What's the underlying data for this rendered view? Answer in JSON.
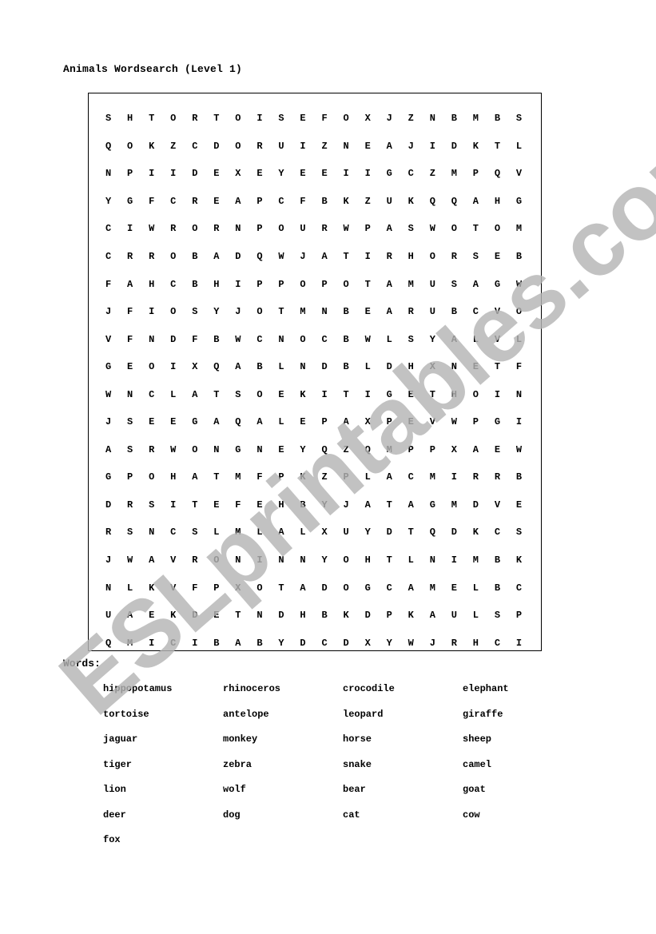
{
  "title": "Animals Wordsearch (Level 1)",
  "grid": [
    [
      "S",
      "H",
      "T",
      "O",
      "R",
      "T",
      "O",
      "I",
      "S",
      "E",
      "F",
      "O",
      "X",
      "J",
      "Z",
      "N",
      "B",
      "M",
      "B",
      "S"
    ],
    [
      "Q",
      "O",
      "K",
      "Z",
      "C",
      "D",
      "O",
      "R",
      "U",
      "I",
      "Z",
      "N",
      "E",
      "A",
      "J",
      "I",
      "D",
      "K",
      "T",
      "L"
    ],
    [
      "N",
      "P",
      "I",
      "I",
      "D",
      "E",
      "X",
      "E",
      "Y",
      "E",
      "E",
      "I",
      "I",
      "G",
      "C",
      "Z",
      "M",
      "P",
      "Q",
      "V"
    ],
    [
      "Y",
      "G",
      "F",
      "C",
      "R",
      "E",
      "A",
      "P",
      "C",
      "F",
      "B",
      "K",
      "Z",
      "U",
      "K",
      "Q",
      "Q",
      "A",
      "H",
      "G"
    ],
    [
      "C",
      "I",
      "W",
      "R",
      "O",
      "R",
      "N",
      "P",
      "O",
      "U",
      "R",
      "W",
      "P",
      "A",
      "S",
      "W",
      "O",
      "T",
      "O",
      "M"
    ],
    [
      "C",
      "R",
      "R",
      "O",
      "B",
      "A",
      "D",
      "Q",
      "W",
      "J",
      "A",
      "T",
      "I",
      "R",
      "H",
      "O",
      "R",
      "S",
      "E",
      "B"
    ],
    [
      "F",
      "A",
      "H",
      "C",
      "B",
      "H",
      "I",
      "P",
      "P",
      "O",
      "P",
      "O",
      "T",
      "A",
      "M",
      "U",
      "S",
      "A",
      "G",
      "W"
    ],
    [
      "J",
      "F",
      "I",
      "O",
      "S",
      "Y",
      "J",
      "O",
      "T",
      "M",
      "N",
      "B",
      "E",
      "A",
      "R",
      "U",
      "B",
      "C",
      "V",
      "O"
    ],
    [
      "V",
      "F",
      "N",
      "D",
      "F",
      "B",
      "W",
      "C",
      "N",
      "O",
      "C",
      "B",
      "W",
      "L",
      "S",
      "Y",
      "A",
      "L",
      "V",
      "L"
    ],
    [
      "G",
      "E",
      "O",
      "I",
      "X",
      "Q",
      "A",
      "B",
      "L",
      "N",
      "D",
      "B",
      "L",
      "D",
      "H",
      "X",
      "N",
      "E",
      "T",
      "F"
    ],
    [
      "W",
      "N",
      "C",
      "L",
      "A",
      "T",
      "S",
      "O",
      "E",
      "K",
      "I",
      "T",
      "I",
      "G",
      "E",
      "T",
      "H",
      "O",
      "I",
      "N"
    ],
    [
      "J",
      "S",
      "E",
      "E",
      "G",
      "A",
      "Q",
      "A",
      "L",
      "E",
      "P",
      "A",
      "X",
      "P",
      "E",
      "V",
      "W",
      "P",
      "G",
      "I"
    ],
    [
      "A",
      "S",
      "R",
      "W",
      "O",
      "N",
      "G",
      "N",
      "E",
      "Y",
      "Q",
      "Z",
      "Q",
      "M",
      "P",
      "P",
      "X",
      "A",
      "E",
      "W"
    ],
    [
      "G",
      "P",
      "O",
      "H",
      "A",
      "T",
      "M",
      "F",
      "P",
      "K",
      "Z",
      "P",
      "L",
      "A",
      "C",
      "M",
      "I",
      "R",
      "R",
      "B"
    ],
    [
      "D",
      "R",
      "S",
      "I",
      "T",
      "E",
      "F",
      "E",
      "H",
      "B",
      "Y",
      "J",
      "A",
      "T",
      "A",
      "G",
      "M",
      "D",
      "V",
      "E"
    ],
    [
      "R",
      "S",
      "N",
      "C",
      "S",
      "L",
      "M",
      "L",
      "A",
      "L",
      "X",
      "U",
      "Y",
      "D",
      "T",
      "Q",
      "D",
      "K",
      "C",
      "S"
    ],
    [
      "J",
      "W",
      "A",
      "V",
      "R",
      "O",
      "N",
      "I",
      "N",
      "N",
      "Y",
      "O",
      "H",
      "T",
      "L",
      "N",
      "I",
      "M",
      "B",
      "K"
    ],
    [
      "N",
      "L",
      "K",
      "V",
      "F",
      "P",
      "X",
      "O",
      "T",
      "A",
      "D",
      "O",
      "G",
      "C",
      "A",
      "M",
      "E",
      "L",
      "B",
      "C"
    ],
    [
      "U",
      "A",
      "E",
      "K",
      "D",
      "E",
      "T",
      "N",
      "D",
      "H",
      "B",
      "K",
      "D",
      "P",
      "K",
      "A",
      "U",
      "L",
      "S",
      "P"
    ],
    [
      "Q",
      "M",
      "I",
      "C",
      "I",
      "B",
      "A",
      "B",
      "Y",
      "D",
      "C",
      "D",
      "X",
      "Y",
      "W",
      "J",
      "R",
      "H",
      "C",
      "I"
    ]
  ],
  "words_label": "Words:",
  "words": [
    "hippopotamus",
    "rhinoceros",
    "crocodile",
    "elephant",
    "tortoise",
    "antelope",
    "leopard",
    "giraffe",
    "jaguar",
    "monkey",
    "horse",
    "sheep",
    "tiger",
    "zebra",
    "snake",
    "camel",
    "lion",
    "wolf",
    "bear",
    "goat",
    "deer",
    "dog",
    "cat",
    "cow",
    "fox"
  ],
  "watermark": "ESLprintables.com"
}
